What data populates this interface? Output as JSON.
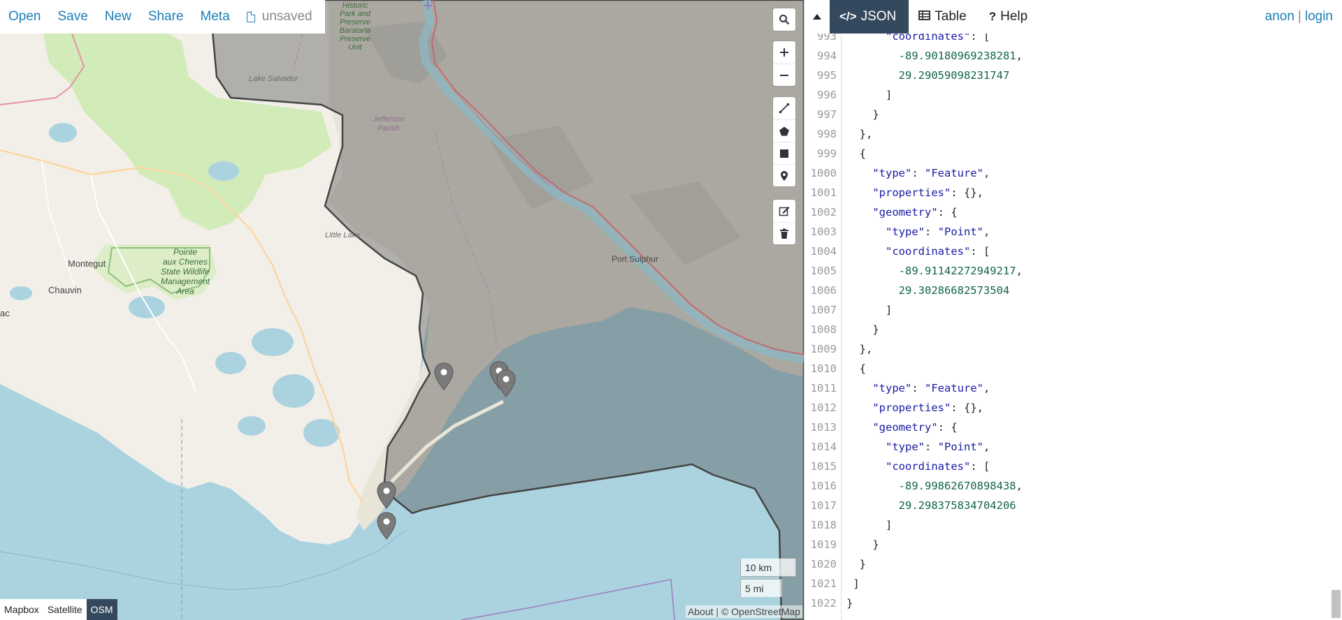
{
  "top_menu": {
    "open_label": "Open",
    "save_label": "Save",
    "new_label": "New",
    "share_label": "Share",
    "meta_label": "Meta",
    "file_status": "unsaved"
  },
  "pane": {
    "tabs": [
      {
        "label": "JSON",
        "icon": "code-icon",
        "active": true
      },
      {
        "label": "Table",
        "icon": "table-icon",
        "active": false
      },
      {
        "label": "Help",
        "icon": "question-icon",
        "active": false
      }
    ],
    "auth": {
      "anon_label": "anon",
      "separator": "|",
      "login_label": "login"
    }
  },
  "map": {
    "labels": {
      "historic_park": "Historic\nPark and\nPreserve\nBarataria\nPreserve\nUnit",
      "lake_salvador": "Lake Salvador",
      "jefferson_parish": "Jefferson\nParish",
      "little_lake": "Little Lake",
      "port_sulphur": "Port Sulphur",
      "montegut": "Montegut",
      "chauvin": "Chauvin",
      "ac": "ac",
      "pointe_aux_chenes": "Pointe\naux Chenes\nState Wildlife\nManagement\nArea"
    },
    "scale": {
      "metric": "10 km",
      "imperial": "5 mi"
    },
    "layers": [
      {
        "label": "Mapbox",
        "active": false
      },
      {
        "label": "Satellite",
        "active": false
      },
      {
        "label": "OSM",
        "active": true
      }
    ],
    "attribution": {
      "about": "About",
      "separator": "|",
      "osm": "© OpenStreetMap"
    },
    "markers_count": 5,
    "colors": {
      "water": "#aad3df",
      "land": "#f2efe9",
      "overlay": "#555555",
      "marker": "#7a7a7a",
      "accent": "#1b7eb8",
      "active_tab": "#34495e"
    },
    "controls": [
      "search-icon",
      "zoom-in-icon",
      "zoom-out-icon",
      "draw-line-icon",
      "draw-polygon-icon",
      "draw-rectangle-icon",
      "draw-marker-icon",
      "edit-icon",
      "delete-icon"
    ]
  },
  "editor": {
    "lines": [
      {
        "n": "993",
        "text": "      \"coordinates\": ["
      },
      {
        "n": "994",
        "text": "        -89.90180969238281,"
      },
      {
        "n": "995",
        "text": "        29.29059098231747"
      },
      {
        "n": "996",
        "text": "      ]"
      },
      {
        "n": "997",
        "text": "    }"
      },
      {
        "n": "998",
        "text": "  },"
      },
      {
        "n": "999",
        "text": "  {"
      },
      {
        "n": "1000",
        "text": "    \"type\": \"Feature\","
      },
      {
        "n": "1001",
        "text": "    \"properties\": {},"
      },
      {
        "n": "1002",
        "text": "    \"geometry\": {"
      },
      {
        "n": "1003",
        "text": "      \"type\": \"Point\","
      },
      {
        "n": "1004",
        "text": "      \"coordinates\": ["
      },
      {
        "n": "1005",
        "text": "        -89.91142272949217,"
      },
      {
        "n": "1006",
        "text": "        29.30286682573504"
      },
      {
        "n": "1007",
        "text": "      ]"
      },
      {
        "n": "1008",
        "text": "    }"
      },
      {
        "n": "1009",
        "text": "  },"
      },
      {
        "n": "1010",
        "text": "  {"
      },
      {
        "n": "1011",
        "text": "    \"type\": \"Feature\","
      },
      {
        "n": "1012",
        "text": "    \"properties\": {},"
      },
      {
        "n": "1013",
        "text": "    \"geometry\": {"
      },
      {
        "n": "1014",
        "text": "      \"type\": \"Point\","
      },
      {
        "n": "1015",
        "text": "      \"coordinates\": ["
      },
      {
        "n": "1016",
        "text": "        -89.99862670898438,"
      },
      {
        "n": "1017",
        "text": "        29.298375834704206"
      },
      {
        "n": "1018",
        "text": "      ]"
      },
      {
        "n": "1019",
        "text": "    }"
      },
      {
        "n": "1020",
        "text": "  }"
      },
      {
        "n": "1021",
        "text": " ]"
      },
      {
        "n": "1022",
        "text": "}"
      }
    ]
  }
}
